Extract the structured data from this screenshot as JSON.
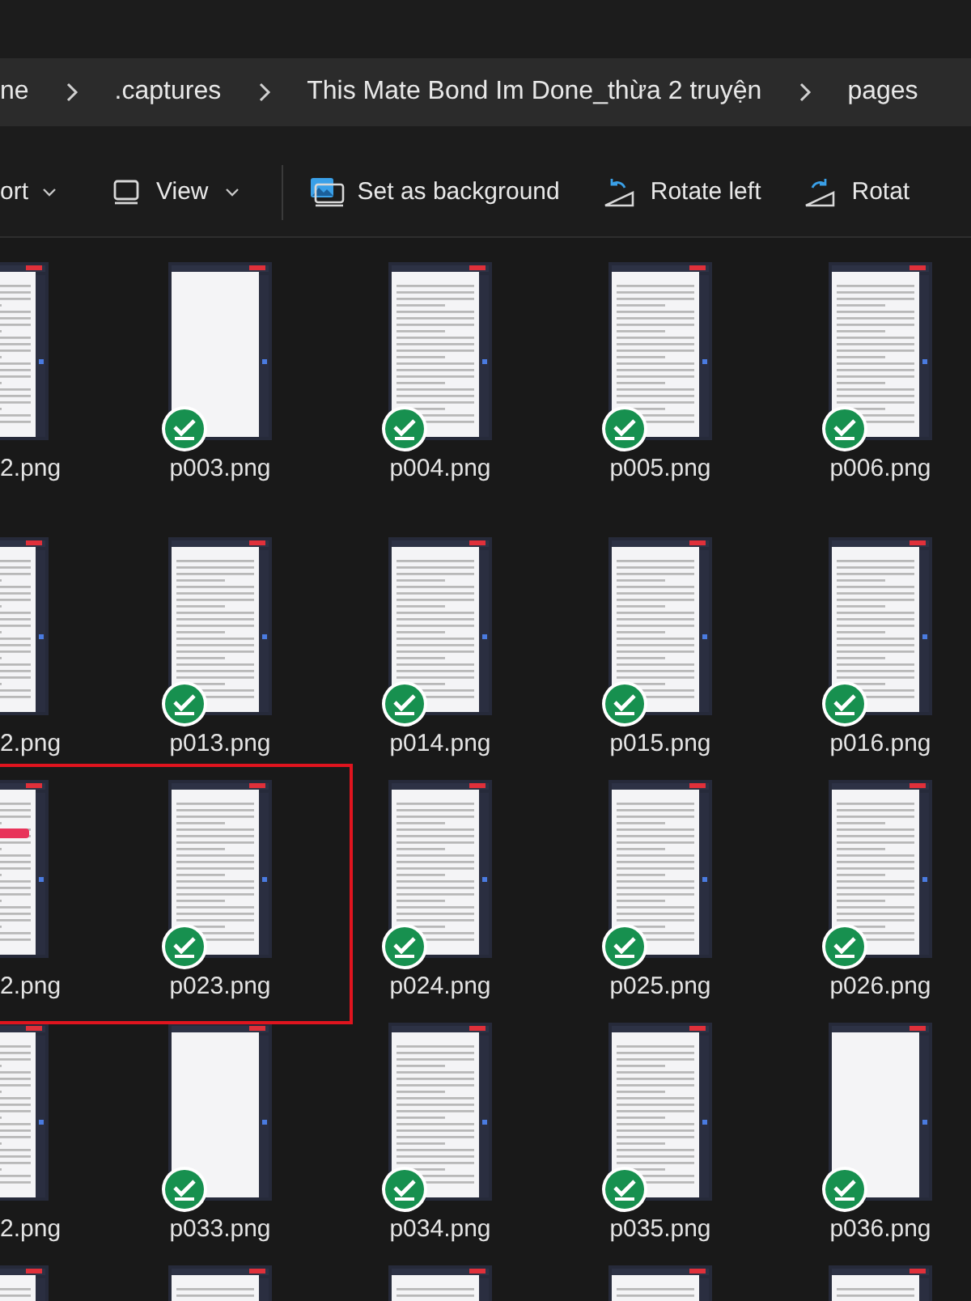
{
  "breadcrumb": [
    ".captures",
    "This Mate Bond Im Done_thừa 2 truyện",
    "pages"
  ],
  "breadcrumb_first": "ne",
  "toolbar": [
    {
      "kind": "dropdown",
      "label": "ort"
    },
    {
      "kind": "view",
      "label": "View"
    },
    {
      "kind": "background",
      "label": "Set as background"
    },
    {
      "kind": "rotate_left",
      "label": "Rotate left"
    },
    {
      "kind": "rotate_right",
      "label": "Rotat"
    }
  ],
  "annotation": {
    "kind": "rectangle",
    "color": "#e0141e"
  },
  "rows": [
    {
      "items": [
        {
          "name": "2.png",
          "kind": "text"
        },
        {
          "name": "p003.png",
          "kind": "blank"
        },
        {
          "name": "p004.png",
          "kind": "text"
        },
        {
          "name": "p005.png",
          "kind": "text"
        },
        {
          "name": "p006.png",
          "kind": "text"
        }
      ]
    },
    {
      "items": [
        {
          "name": "2.png",
          "kind": "text"
        },
        {
          "name": "p013.png",
          "kind": "text"
        },
        {
          "name": "p014.png",
          "kind": "text"
        },
        {
          "name": "p015.png",
          "kind": "text"
        },
        {
          "name": "p016.png",
          "kind": "text"
        }
      ]
    },
    {
      "items": [
        {
          "name": "2.png",
          "kind": "highlight"
        },
        {
          "name": "p023.png",
          "kind": "text"
        },
        {
          "name": "p024.png",
          "kind": "text"
        },
        {
          "name": "p025.png",
          "kind": "text"
        },
        {
          "name": "p026.png",
          "kind": "text"
        }
      ]
    },
    {
      "items": [
        {
          "name": "2.png",
          "kind": "text"
        },
        {
          "name": "p033.png",
          "kind": "blank"
        },
        {
          "name": "p034.png",
          "kind": "text"
        },
        {
          "name": "p035.png",
          "kind": "text"
        },
        {
          "name": "p036.png",
          "kind": "blank"
        }
      ]
    },
    {
      "items": [
        {
          "kind": "text"
        },
        {
          "kind": "text"
        },
        {
          "kind": "text"
        },
        {
          "kind": "text"
        },
        {
          "kind": "text"
        }
      ]
    }
  ]
}
